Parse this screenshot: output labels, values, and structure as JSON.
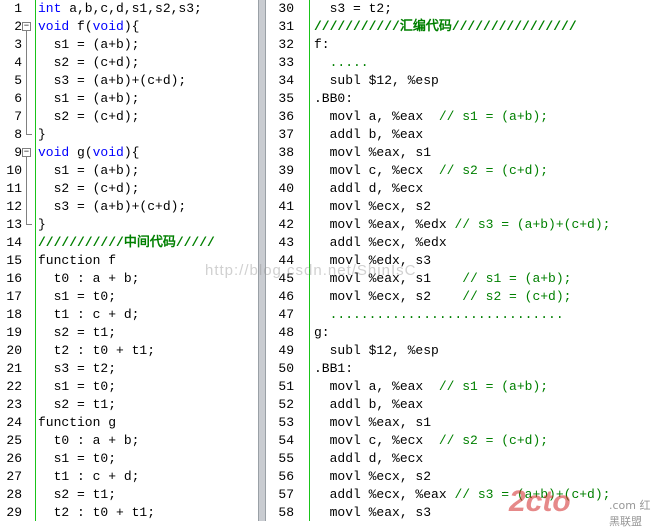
{
  "left_pane": {
    "lines": [
      {
        "n": "1",
        "segs": [
          {
            "t": "int",
            "c": "k"
          },
          {
            "t": " a,b,c,d,s1,s2,s3;"
          }
        ]
      },
      {
        "n": "2",
        "fold": "open",
        "segs": [
          {
            "t": "void",
            "c": "k"
          },
          {
            "t": " f("
          },
          {
            "t": "void",
            "c": "k"
          },
          {
            "t": "){"
          }
        ]
      },
      {
        "n": "3",
        "segs": [
          {
            "t": "  s1 = (a+b);"
          }
        ]
      },
      {
        "n": "4",
        "segs": [
          {
            "t": "  s2 = (c+d);"
          }
        ]
      },
      {
        "n": "5",
        "segs": [
          {
            "t": "  s3 = (a+b)+(c+d);"
          }
        ]
      },
      {
        "n": "6",
        "segs": [
          {
            "t": "  s1 = (a+b);"
          }
        ]
      },
      {
        "n": "7",
        "segs": [
          {
            "t": "  s2 = (c+d);"
          }
        ]
      },
      {
        "n": "8",
        "fold": "end",
        "segs": [
          {
            "t": "}"
          }
        ]
      },
      {
        "n": "9",
        "fold": "open",
        "segs": [
          {
            "t": "void",
            "c": "k"
          },
          {
            "t": " g("
          },
          {
            "t": "void",
            "c": "k"
          },
          {
            "t": "){"
          }
        ]
      },
      {
        "n": "10",
        "segs": [
          {
            "t": "  s1 = (a+b);"
          }
        ]
      },
      {
        "n": "11",
        "segs": [
          {
            "t": "  s2 = (c+d);"
          }
        ]
      },
      {
        "n": "12",
        "segs": [
          {
            "t": "  s3 = (a+b)+(c+d);"
          }
        ]
      },
      {
        "n": "13",
        "fold": "end",
        "segs": [
          {
            "t": "}"
          }
        ]
      },
      {
        "n": "14",
        "segs": [
          {
            "t": "///////////中间代码/////",
            "c": "cb"
          }
        ]
      },
      {
        "n": "15",
        "segs": [
          {
            "t": "function f"
          }
        ]
      },
      {
        "n": "16",
        "segs": [
          {
            "t": "  t0 : a + b;"
          }
        ]
      },
      {
        "n": "17",
        "segs": [
          {
            "t": "  s1 = t0;"
          }
        ]
      },
      {
        "n": "18",
        "segs": [
          {
            "t": "  t1 : c + d;"
          }
        ]
      },
      {
        "n": "19",
        "segs": [
          {
            "t": "  s2 = t1;"
          }
        ]
      },
      {
        "n": "20",
        "segs": [
          {
            "t": "  t2 : t0 + t1;"
          }
        ]
      },
      {
        "n": "21",
        "segs": [
          {
            "t": "  s3 = t2;"
          }
        ]
      },
      {
        "n": "22",
        "segs": [
          {
            "t": "  s1 = t0;"
          }
        ]
      },
      {
        "n": "23",
        "segs": [
          {
            "t": "  s2 = t1;"
          }
        ]
      },
      {
        "n": "24",
        "segs": [
          {
            "t": "function g"
          }
        ]
      },
      {
        "n": "25",
        "segs": [
          {
            "t": "  t0 : a + b;"
          }
        ]
      },
      {
        "n": "26",
        "segs": [
          {
            "t": "  s1 = t0;"
          }
        ]
      },
      {
        "n": "27",
        "segs": [
          {
            "t": "  t1 : c + d;"
          }
        ]
      },
      {
        "n": "28",
        "segs": [
          {
            "t": "  s2 = t1;"
          }
        ]
      },
      {
        "n": "29",
        "segs": [
          {
            "t": "  t2 : t0 + t1;"
          }
        ]
      }
    ]
  },
  "right_pane": {
    "lines": [
      {
        "n": "30",
        "segs": [
          {
            "t": "  s3 = t2;"
          }
        ]
      },
      {
        "n": "31",
        "segs": [
          {
            "t": "///////////汇编代码////////////////",
            "c": "cb"
          }
        ]
      },
      {
        "n": "32",
        "segs": [
          {
            "t": "f:"
          }
        ]
      },
      {
        "n": "33",
        "segs": [
          {
            "t": "  .....",
            "c": "c"
          }
        ]
      },
      {
        "n": "34",
        "segs": [
          {
            "t": "  subl $12, %esp"
          }
        ]
      },
      {
        "n": "35",
        "segs": [
          {
            "t": ".BB0:"
          }
        ]
      },
      {
        "n": "36",
        "segs": [
          {
            "t": "  movl a, %eax  "
          },
          {
            "t": "// s1 = (a+b);",
            "c": "c"
          }
        ]
      },
      {
        "n": "37",
        "segs": [
          {
            "t": "  addl b, %eax"
          }
        ]
      },
      {
        "n": "38",
        "segs": [
          {
            "t": "  movl %eax, s1"
          }
        ]
      },
      {
        "n": "39",
        "segs": [
          {
            "t": "  movl c, %ecx  "
          },
          {
            "t": "// s2 = (c+d);",
            "c": "c"
          }
        ]
      },
      {
        "n": "40",
        "segs": [
          {
            "t": "  addl d, %ecx"
          }
        ]
      },
      {
        "n": "41",
        "segs": [
          {
            "t": "  movl %ecx, s2"
          }
        ]
      },
      {
        "n": "42",
        "segs": [
          {
            "t": "  movl %eax, %edx "
          },
          {
            "t": "// s3 = (a+b)+(c+d);",
            "c": "c"
          }
        ]
      },
      {
        "n": "43",
        "segs": [
          {
            "t": "  addl %ecx, %edx"
          }
        ]
      },
      {
        "n": "44",
        "segs": [
          {
            "t": "  movl %edx, s3"
          }
        ]
      },
      {
        "n": "45",
        "segs": [
          {
            "t": "  movl %eax, s1    "
          },
          {
            "t": "// s1 = (a+b);",
            "c": "c"
          }
        ]
      },
      {
        "n": "46",
        "segs": [
          {
            "t": "  movl %ecx, s2    "
          },
          {
            "t": "// s2 = (c+d);",
            "c": "c"
          }
        ]
      },
      {
        "n": "47",
        "segs": [
          {
            "t": "  ..............................",
            "c": "c"
          }
        ]
      },
      {
        "n": "48",
        "segs": [
          {
            "t": "g:"
          }
        ]
      },
      {
        "n": "49",
        "segs": [
          {
            "t": "  subl $12, %esp"
          }
        ]
      },
      {
        "n": "50",
        "segs": [
          {
            "t": ".BB1:"
          }
        ]
      },
      {
        "n": "51",
        "segs": [
          {
            "t": "  movl a, %eax  "
          },
          {
            "t": "// s1 = (a+b);",
            "c": "c"
          }
        ]
      },
      {
        "n": "52",
        "segs": [
          {
            "t": "  addl b, %eax"
          }
        ]
      },
      {
        "n": "53",
        "segs": [
          {
            "t": "  movl %eax, s1"
          }
        ]
      },
      {
        "n": "54",
        "segs": [
          {
            "t": "  movl c, %ecx  "
          },
          {
            "t": "// s2 = (c+d);",
            "c": "c"
          }
        ]
      },
      {
        "n": "55",
        "segs": [
          {
            "t": "  addl d, %ecx"
          }
        ]
      },
      {
        "n": "56",
        "segs": [
          {
            "t": "  movl %ecx, s2"
          }
        ]
      },
      {
        "n": "57",
        "segs": [
          {
            "t": "  addl %ecx, %eax "
          },
          {
            "t": "// s3 = (a+b)+(c+d);",
            "c": "c"
          }
        ]
      },
      {
        "n": "58",
        "segs": [
          {
            "t": "  movl %eax, s3"
          }
        ]
      }
    ]
  },
  "watermark": {
    "text": "http://blog.csdn.net/ShinIsC"
  },
  "site_logo": {
    "big": "2cto",
    "small": ".com 红黑联盟"
  },
  "colors": {
    "keyword": "#0000ff",
    "comment": "#008000",
    "margin_line": "#19c319",
    "splitter": "#c9ccd1"
  },
  "icons": {
    "fold_open": "fold-minus-icon",
    "fold_end": "fold-end-icon"
  }
}
